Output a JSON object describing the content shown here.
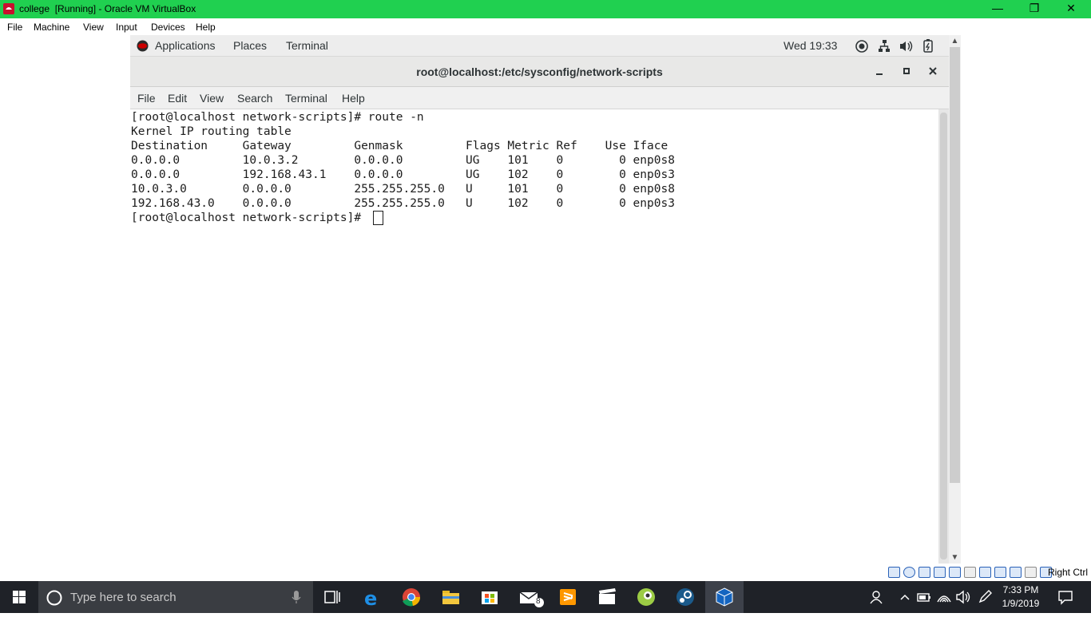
{
  "host_window": {
    "title": "college  [Running] - Oracle VM VirtualBox",
    "menu": [
      "File",
      "Machine",
      "View",
      "Input",
      "Devices",
      "Help"
    ],
    "controls": {
      "minimize": "—",
      "restore": "❐",
      "close": "✕"
    }
  },
  "gnome_bar": {
    "applications": "Applications",
    "places": "Places",
    "terminal": "Terminal",
    "clock": "Wed 19:33"
  },
  "terminal_window": {
    "title": "root@localhost:/etc/sysconfig/network-scripts",
    "menu": [
      "File",
      "Edit",
      "View",
      "Search",
      "Terminal",
      "Help"
    ],
    "lines": [
      "[root@localhost network-scripts]# route -n",
      "Kernel IP routing table",
      "Destination     Gateway         Genmask         Flags Metric Ref    Use Iface",
      "0.0.0.0         10.0.3.2        0.0.0.0         UG    101    0        0 enp0s8",
      "0.0.0.0         192.168.43.1    0.0.0.0         UG    102    0        0 enp0s3",
      "10.0.3.0        0.0.0.0         255.255.255.0   U     101    0        0 enp0s8",
      "192.168.43.0    0.0.0.0         255.255.255.0   U     102    0        0 enp0s3",
      "[root@localhost network-scripts]# "
    ]
  },
  "vbox_status": {
    "host_key": "Right Ctrl"
  },
  "taskbar": {
    "search_placeholder": "Type here to search",
    "mail_badge": "8",
    "time": "7:33 PM",
    "date": "1/9/2019"
  }
}
